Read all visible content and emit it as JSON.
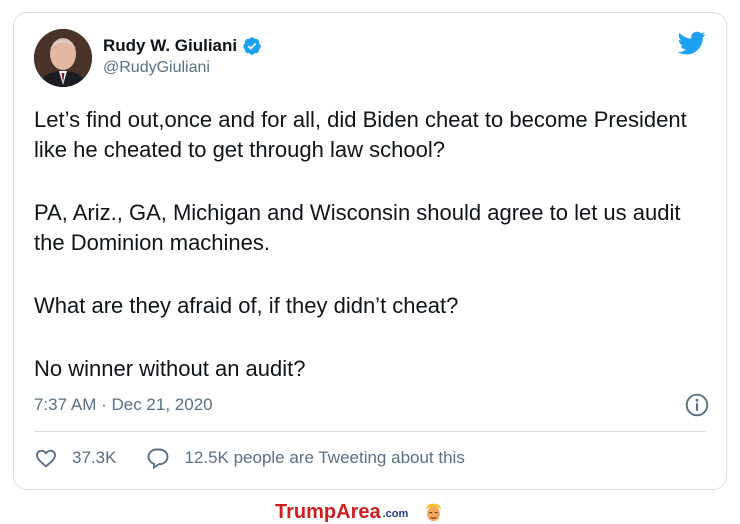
{
  "tweet": {
    "display_name": "Rudy W. Giuliani",
    "handle": "@RudyGiuliani",
    "paragraphs": [
      "Let’s find out,once and for all, did Biden cheat to become President like he cheated to get through law school?",
      "PA, Ariz., GA, Michigan and Wisconsin should agree to let us audit the Dominion machines.",
      "What are they afraid of, if they didn’t cheat?",
      "No winner without an audit?"
    ],
    "timestamp": "7:37 AM · Dec 21, 2020",
    "likes": "37.3K",
    "conversation": "12.5K people are Tweeting about this"
  },
  "watermark": {
    "brand_part1": "Trump",
    "brand_part2": "Area",
    "brand_suffix": ".com"
  },
  "icons": {
    "verified": "verified-badge-icon",
    "platform": "twitter-bird-icon",
    "info": "info-icon",
    "like": "heart-icon",
    "reply": "speech-bubble-icon"
  },
  "colors": {
    "twitter_blue": "#1da1f2",
    "secondary_text": "#5b7083",
    "primary_text": "#0f1419",
    "border": "#d6dfe5",
    "brand_red": "#cc1f1f",
    "brand_blue": "#1f3a8a"
  }
}
